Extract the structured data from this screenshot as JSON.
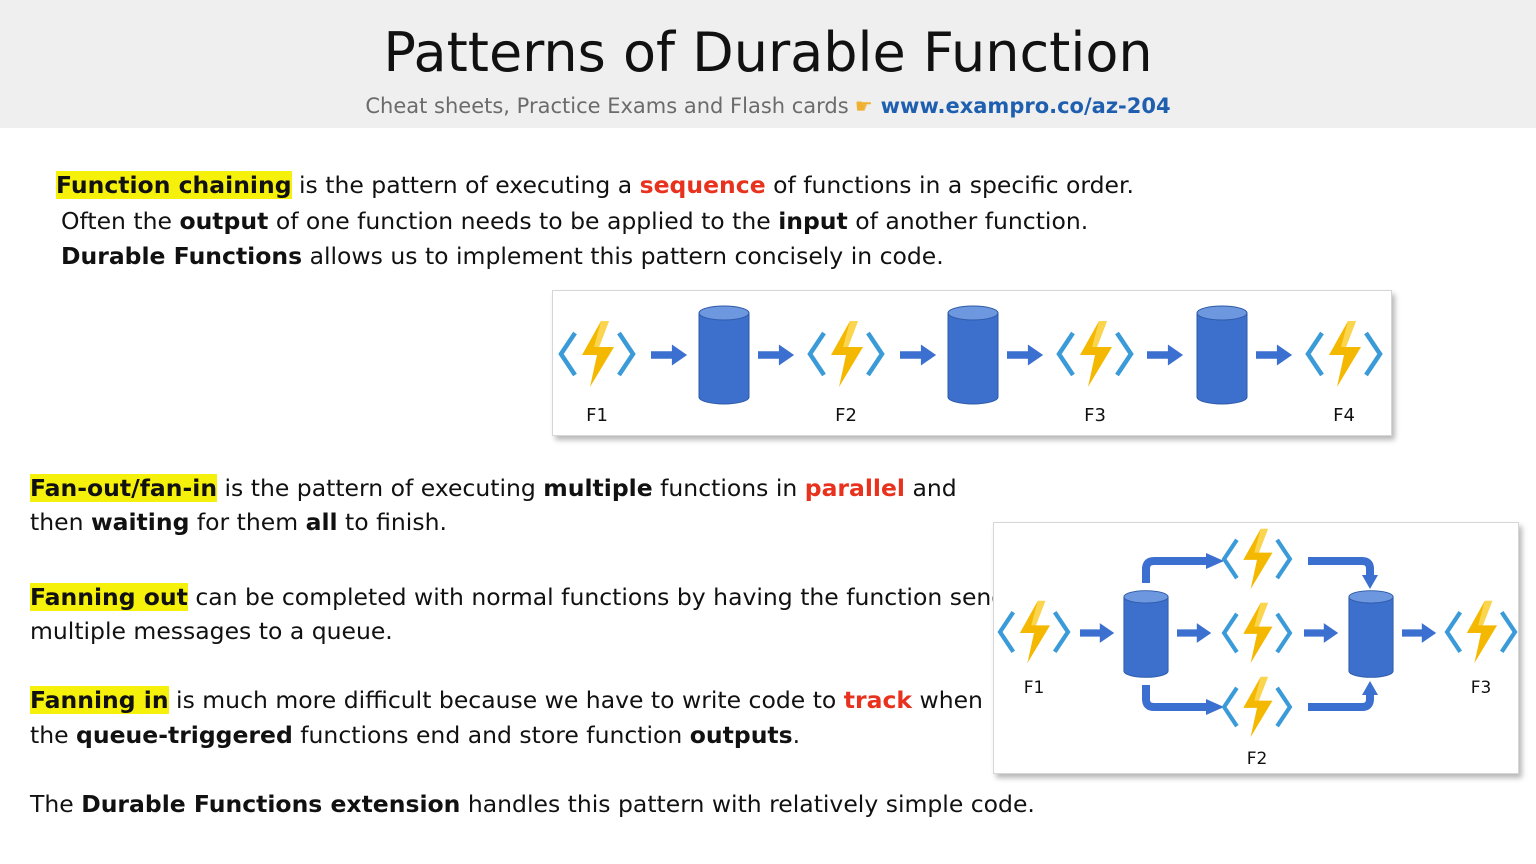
{
  "header": {
    "title": "Patterns of Durable Function",
    "subtitle_text": "Cheat sheets, Practice Exams and Flash cards",
    "subtitle_link": "www.exampro.co/az-204"
  },
  "chaining": {
    "term": "Function chaining",
    "l1_a": " is the pattern of executing a ",
    "l1_red": "sequence",
    "l1_b": " of functions in a specific order.",
    "l2_a": "Often the ",
    "l2_b1": "output",
    "l2_c": " of one function needs to be applied to the ",
    "l2_b2": "input",
    "l2_d": " of another function.",
    "l3_b": "Durable Functions",
    "l3_a": " allows us to implement this pattern concisely in code.",
    "diagram_labels": [
      "F1",
      "F2",
      "F3",
      "F4"
    ]
  },
  "fanout": {
    "term": "Fan-out/fan-in",
    "l1_a": " is the pattern of executing ",
    "l1_b": "multiple",
    "l1_c": " functions in ",
    "l1_red": "parallel",
    "l1_d": " and",
    "l2_a": "then ",
    "l2_b1": "waiting",
    "l2_c": " for them ",
    "l2_b2": "all",
    "l2_d": " to finish.",
    "out_term": "Fanning out",
    "out_l1": " can be completed with normal functions by having the function send",
    "out_l2": "multiple messages to a queue.",
    "in_term": "Fanning in",
    "in_l1_a": " is much more difficult because we have to write code to ",
    "in_l1_red": "track",
    "in_l1_b": " when",
    "in_l2_a": "the ",
    "in_l2_b1": "queue-triggered",
    "in_l2_c": " functions end and store function ",
    "in_l2_b2": "outputs",
    "in_l2_d": ".",
    "ext_a": "The ",
    "ext_b": "Durable Functions extension",
    "ext_c": " handles this pattern with relatively simple code.",
    "diagram_labels": [
      "F1",
      "F2",
      "F3"
    ]
  },
  "colors": {
    "highlight": "#f6f10a",
    "emphasis_red": "#e8321e",
    "link_blue": "#1f5fb0",
    "arrow_blue": "#3b6fd0",
    "bolt_yellow": "#f5b800",
    "bracket_blue": "#3a9bd8"
  },
  "icons": [
    "pointing-hand-icon",
    "azure-function-icon",
    "storage-cylinder-icon",
    "right-arrow-icon"
  ]
}
